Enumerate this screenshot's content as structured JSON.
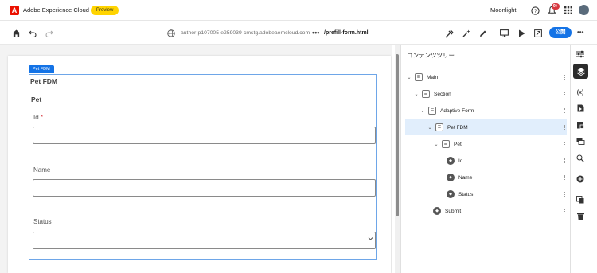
{
  "header": {
    "app_name": "Adobe Experience Cloud",
    "preview_badge": "Preview",
    "user_name": "Moonlight",
    "notification_count": "9+"
  },
  "toolbar": {
    "url": "author-p107005-e259039-cmstg.adobeaemcloud.com",
    "more_label": "•••",
    "page_name": "/prefill-form.html",
    "publish_label": "公開",
    "more_right": "•••"
  },
  "form": {
    "component_tag": "Pet FDM",
    "fdm_title": "Pet FDM",
    "panel_title": "Pet",
    "fields": [
      {
        "label": "Id",
        "required": "*",
        "value": ""
      },
      {
        "label": "Name",
        "value": ""
      },
      {
        "label": "Status",
        "value": ""
      }
    ]
  },
  "tree": {
    "title": "コンテンツツリー",
    "nodes": [
      {
        "label": "Main"
      },
      {
        "label": "Section"
      },
      {
        "label": "Adaptive Form"
      },
      {
        "label": "Pet FDM"
      },
      {
        "label": "Pet"
      },
      {
        "label": "Id"
      },
      {
        "label": "Name"
      },
      {
        "label": "Status"
      },
      {
        "label": "Submit"
      }
    ]
  },
  "rail": {
    "variables_label": "(x)"
  },
  "colors": {
    "accent": "#1473e6",
    "adobe_red": "#eb1000",
    "preview_yellow": "#ffd400",
    "selected_row": "#e1eefc"
  }
}
